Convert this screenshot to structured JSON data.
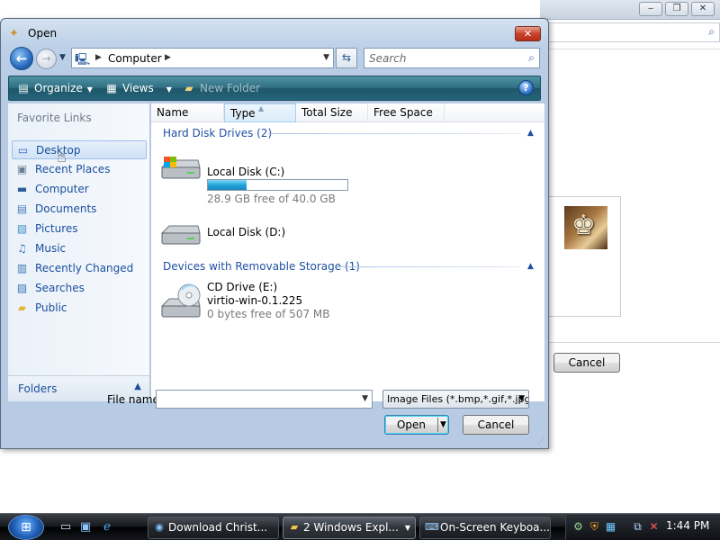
{
  "colors": {
    "accent": "#2f6e82",
    "link": "#1a4f9c",
    "group_header": "#1f4fa3",
    "progress": "#24a6dd"
  },
  "background_window": {
    "search_icon": "search-icon",
    "cancel_label": "Cancel"
  },
  "dialog": {
    "title": "Open",
    "title_icon": "open-file-icon",
    "close_label": "✕",
    "address": {
      "crumb": "Computer"
    },
    "search": {
      "placeholder": "Search"
    },
    "toolbar": {
      "organize": "Organize",
      "views": "Views",
      "new_folder": "New Folder",
      "help": "?"
    },
    "navpane": {
      "header": "Favorite Links",
      "items": [
        {
          "label": "Desktop",
          "icon": "desktop-icon"
        },
        {
          "label": "Recent Places",
          "icon": "recent-places-icon"
        },
        {
          "label": "Computer",
          "icon": "computer-icon"
        },
        {
          "label": "Documents",
          "icon": "documents-icon"
        },
        {
          "label": "Pictures",
          "icon": "pictures-icon"
        },
        {
          "label": "Music",
          "icon": "music-icon"
        },
        {
          "label": "Recently Changed",
          "icon": "recently-changed-icon"
        },
        {
          "label": "Searches",
          "icon": "searches-icon"
        },
        {
          "label": "Public",
          "icon": "public-folder-icon"
        }
      ],
      "folders": "Folders"
    },
    "columns": [
      "Name",
      "Type",
      "Total Size",
      "Free Space"
    ],
    "groups": [
      {
        "header": "Hard Disk Drives (2)"
      },
      {
        "header": "Devices with Removable Storage (1)"
      }
    ],
    "drives": [
      {
        "name": "Local Disk (C:)",
        "sub": "28.9 GB free of 40.0 GB",
        "used_fraction": 0.2775
      },
      {
        "name": "Local Disk (D:)"
      },
      {
        "name": "CD Drive (E:)",
        "label": "virtio-win-0.1.225",
        "sub": "0 bytes free of 507 MB"
      }
    ],
    "file_name_label": "File name:",
    "file_name_value": "",
    "filter": "Image Files (*.bmp,*.gif,*.jpg,*",
    "open_label": "Open",
    "cancel_label": "Cancel"
  },
  "taskbar": {
    "buttons": [
      {
        "label": "Download Christ...",
        "icon": "browser-icon"
      },
      {
        "label": "2 Windows Expl...",
        "icon": "folder-icon"
      },
      {
        "label": "On-Screen Keyboa...",
        "icon": "keyboard-icon"
      }
    ],
    "clock": "1:44 PM"
  }
}
